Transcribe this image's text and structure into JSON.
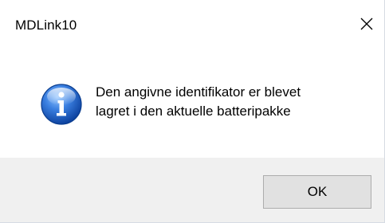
{
  "window": {
    "title": "MDLink10",
    "close_icon": "close-icon"
  },
  "dialog": {
    "icon": "info-icon",
    "message_line1": "Den angivne identifikator er blevet",
    "message_line2": "lagret i den aktuelle batteripakke"
  },
  "buttons": {
    "ok_label": "OK"
  },
  "colors": {
    "footer_background": "#f0f0f0",
    "button_background": "#e1e1e1",
    "button_border": "#adadad",
    "icon_blue": "#1c5cc2"
  }
}
